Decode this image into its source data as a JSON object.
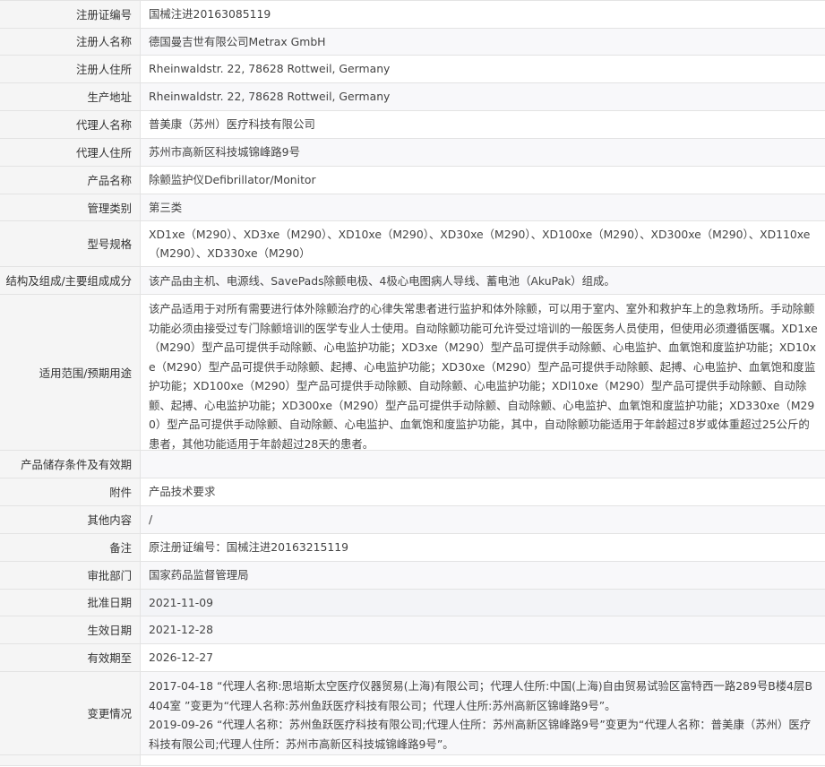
{
  "rows": [
    {
      "label": "注册证编号",
      "value": "国械注进20163085119"
    },
    {
      "label": "注册人名称",
      "value": "德国曼吉世有限公司Metrax GmbH"
    },
    {
      "label": "注册人住所",
      "value": "Rheinwaldstr. 22, 78628 Rottweil, Germany"
    },
    {
      "label": "生产地址",
      "value": "Rheinwaldstr. 22, 78628 Rottweil, Germany"
    },
    {
      "label": "代理人名称",
      "value": "普美康（苏州）医疗科技有限公司"
    },
    {
      "label": "代理人住所",
      "value": "苏州市高新区科技城锦峰路9号"
    },
    {
      "label": "产品名称",
      "value": "除颤监护仪Defibrillator/Monitor"
    },
    {
      "label": "管理类别",
      "value": "第三类"
    },
    {
      "label": "型号规格",
      "value": "XD1xe（M290）、XD3xe（M290）、XD10xe（M290）、XD30xe（M290）、XD100xe（M290）、XD300xe（M290）、XD110xe（M290）、XD330xe（M290）"
    },
    {
      "label": "结构及组成/主要组成成分",
      "value": "该产品由主机、电源线、SavePads除颤电极、4极心电图病人导线、蓄电池（AkuPak）组成。"
    },
    {
      "label": "适用范围/预期用途",
      "value": "该产品适用于对所有需要进行体外除颤治疗的心律失常患者进行监护和体外除颤，可以用于室内、室外和救护车上的急救场所。手动除颤功能必须由接受过专门除颤培训的医学专业人士使用。自动除颤功能可允许受过培训的一般医务人员使用，但使用必须遵循医嘱。XD1xe（M290）型产品可提供手动除颤、心电监护功能；XD3xe（M290）型产品可提供手动除颤、心电监护、血氧饱和度监护功能；XD10xe（M290）型产品可提供手动除颤、起搏、心电监护功能；XD30xe（M290）型产品可提供手动除颤、起搏、心电监护、血氧饱和度监护功能；XD100xe（M290）型产品可提供手动除颤、自动除颤、心电监护功能；XDl10xe（M290）型产品可提供手动除颤、自动除颤、起搏、心电监护功能；XD300xe（M290）型产品可提供手动除颤、自动除颤、心电监护、血氧饱和度监护功能；XD330xe（M290）型产品可提供手动除颤、自动除颤、心电监护、血氧饱和度监护功能，其中，自动除颤功能适用于年龄超过8岁或体重超过25公斤的患者，其他功能适用于年龄超过28天的患者。"
    },
    {
      "label": "产品储存条件及有效期",
      "value": ""
    },
    {
      "label": "附件",
      "value": "产品技术要求"
    },
    {
      "label": "其他内容",
      "value": "/"
    },
    {
      "label": "备注",
      "value": "原注册证编号：国械注进20163215119"
    },
    {
      "label": "审批部门",
      "value": "国家药品监督管理局"
    },
    {
      "label": "批准日期",
      "value": "2021-11-09"
    },
    {
      "label": "生效日期",
      "value": "2021-12-28"
    },
    {
      "label": "有效期至",
      "value": "2026-12-27"
    }
  ],
  "changes": {
    "label": "变更情况",
    "entries": [
      "2017-04-18 “代理人名称:思培斯太空医疗仪器贸易(上海)有限公司；代理人住所:中国(上海)自由贸易试验区富特西一路289号B楼4层B404室 ”变更为“代理人名称:苏州鱼跃医疗科技有限公司；代理人住所:苏州高新区锦峰路9号”。",
      "2019-09-26 “代理人名称：苏州鱼跃医疗科技有限公司;代理人住所：苏州高新区锦峰路9号”变更为“代理人名称：普美康（苏州）医疗科技有限公司;代理人住所：苏州市高新区科技城锦峰路9号”。"
    ]
  }
}
